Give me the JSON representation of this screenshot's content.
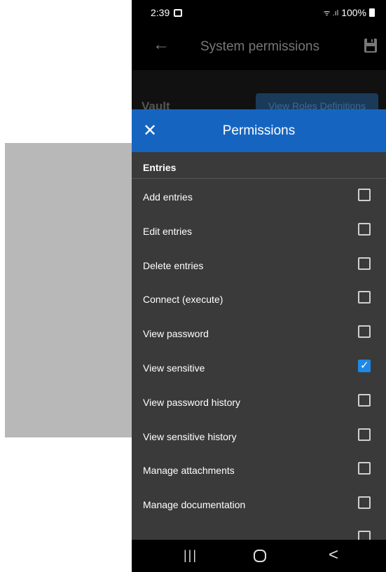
{
  "status_bar": {
    "time": "2:39",
    "battery": "100%",
    "signal": "⁠ᯤ .ıl"
  },
  "app_bar": {
    "back_icon": "←",
    "title": "System permissions"
  },
  "background": {
    "vault_label": "Vault",
    "roles_button": "View Roles Definitions"
  },
  "modal": {
    "close_icon": "✕",
    "title": "Permissions",
    "section": "Entries",
    "items": [
      {
        "label": "Add entries",
        "checked": false
      },
      {
        "label": "Edit entries",
        "checked": false
      },
      {
        "label": "Delete entries",
        "checked": false
      },
      {
        "label": "Connect (execute)",
        "checked": false
      },
      {
        "label": "View password",
        "checked": false
      },
      {
        "label": "View sensitive",
        "checked": true
      },
      {
        "label": "View password history",
        "checked": false
      },
      {
        "label": "View sensitive history",
        "checked": false
      },
      {
        "label": "Manage attachments",
        "checked": false
      },
      {
        "label": "Manage documentation",
        "checked": false
      }
    ]
  },
  "nav": {
    "recent": "|||",
    "back": "<"
  },
  "colors": {
    "accent": "#1565c0",
    "checkbox_checked": "#1e88e5",
    "panel_bg": "#3a3a3a"
  }
}
